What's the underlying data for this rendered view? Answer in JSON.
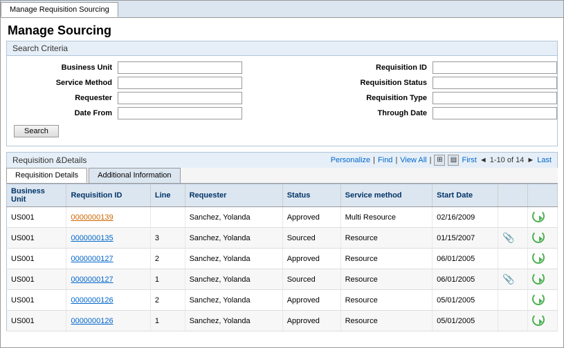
{
  "window": {
    "tab_label": "Manage Requisition Sourcing"
  },
  "page": {
    "title": "Manage Sourcing"
  },
  "search_criteria": {
    "header": "Search Criteria",
    "fields": {
      "business_unit_label": "Business Unit",
      "service_method_label": "Service Method",
      "requester_label": "Requester",
      "date_from_label": "Date From",
      "requisition_id_label": "Requisition ID",
      "requisition_status_label": "Requisition Status",
      "requisition_type_label": "Requisition Type",
      "through_date_label": "Through Date"
    },
    "search_btn": "Search"
  },
  "results": {
    "title": "Requisition &Details",
    "toolbar": {
      "personalize": "Personalize",
      "find": "Find",
      "view_all": "View All",
      "first": "First",
      "last": "Last",
      "page_range": "1-10 of 14"
    },
    "tabs": {
      "tab1": "Requisition Details",
      "tab2": "Additional Information"
    },
    "columns": [
      "Business Unit",
      "Requisition ID",
      "Line",
      "Requester",
      "Status",
      "Service method",
      "Start Date",
      "",
      ""
    ],
    "rows": [
      {
        "business_unit": "US001",
        "req_id": "0000000139",
        "line": "",
        "requester": "Sanchez, Yolanda",
        "status": "Approved",
        "service_method": "Multi Resource",
        "start_date": "02/16/2009",
        "has_attach": false,
        "has_refresh": true
      },
      {
        "business_unit": "US001",
        "req_id": "0000000135",
        "line": "3",
        "requester": "Sanchez, Yolanda",
        "status": "Sourced",
        "service_method": "Resource",
        "start_date": "01/15/2007",
        "has_attach": true,
        "has_refresh": true
      },
      {
        "business_unit": "US001",
        "req_id": "0000000127",
        "line": "2",
        "requester": "Sanchez, Yolanda",
        "status": "Approved",
        "service_method": "Resource",
        "start_date": "06/01/2005",
        "has_attach": false,
        "has_refresh": true
      },
      {
        "business_unit": "US001",
        "req_id": "0000000127",
        "line": "1",
        "requester": "Sanchez, Yolanda",
        "status": "Sourced",
        "service_method": "Resource",
        "start_date": "06/01/2005",
        "has_attach": true,
        "has_refresh": true
      },
      {
        "business_unit": "US001",
        "req_id": "0000000126",
        "line": "2",
        "requester": "Sanchez, Yolanda",
        "status": "Approved",
        "service_method": "Resource",
        "start_date": "05/01/2005",
        "has_attach": false,
        "has_refresh": true
      },
      {
        "business_unit": "US001",
        "req_id": "0000000126",
        "line": "1",
        "requester": "Sanchez, Yolanda",
        "status": "Approved",
        "service_method": "Resource",
        "start_date": "05/01/2005",
        "has_attach": false,
        "has_refresh": true
      }
    ]
  }
}
